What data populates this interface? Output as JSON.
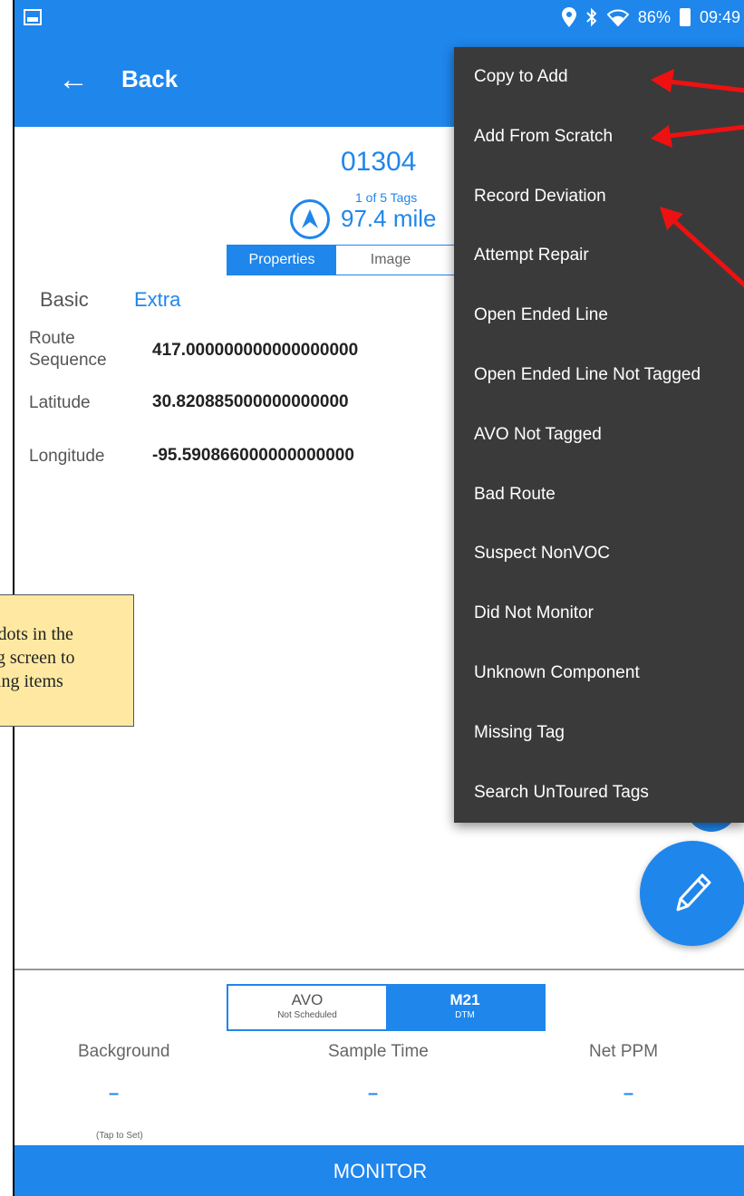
{
  "status_bar": {
    "battery": "86%",
    "time": "09:49"
  },
  "app_bar": {
    "back_label": "Back"
  },
  "tag": {
    "id": "01304",
    "count_text": "1 of 5 Tags",
    "distance": "97.4 mile"
  },
  "view_tabs": {
    "properties": "Properties",
    "image": "Image"
  },
  "detail_tabs": {
    "basic": "Basic",
    "extra": "Extra"
  },
  "properties": [
    {
      "label_line1": "Route",
      "label_line2": "Sequence",
      "value": "417.000000000000000000"
    },
    {
      "label_line1": "Latitude",
      "label_line2": "",
      "value": "30.820885000000000000"
    },
    {
      "label_line1": "Longitude",
      "label_line2": "",
      "value": "-95.590866000000000000"
    }
  ],
  "callout": {
    "line1": "l dots in the",
    "line2": "ag screen to",
    "line3": "ing items”"
  },
  "menu": {
    "items": [
      "Copy to Add",
      "Add From Scratch",
      "Record Deviation",
      "Attempt Repair",
      "Open Ended Line",
      "Open Ended Line Not Tagged",
      "AVO Not Tagged",
      "Bad Route",
      "Suspect NonVOC",
      "Did Not Monitor",
      "Unknown Component",
      "Missing Tag",
      "Search UnToured Tags"
    ]
  },
  "mode_toggle": {
    "avo_title": "AVO",
    "avo_sub": "Not Scheduled",
    "m21_title": "M21",
    "m21_sub": "DTM"
  },
  "measurements": {
    "background_label": "Background",
    "background_value": "–",
    "background_hint": "(Tap to Set)",
    "sample_label": "Sample Time",
    "sample_value": "–",
    "net_label": "Net PPM",
    "net_value": "–"
  },
  "monitor_label": "MONITOR",
  "colors": {
    "primary": "#1f86ec",
    "menu_bg": "#3a3a3a",
    "callout_bg": "#ffe9a2",
    "arrow": "#ee1111"
  }
}
